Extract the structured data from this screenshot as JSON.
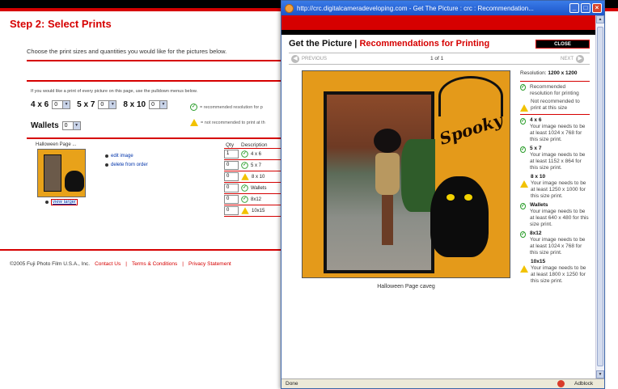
{
  "background_page": {
    "title": "Step 2: Select Prints",
    "intro": "Choose the print sizes and quantities you would like for the pictures below.",
    "pulldown_text": "If you would like a print of every picture on this page, use the pulldown menus below.",
    "sizes": [
      {
        "label": "4 x 6",
        "value": "0"
      },
      {
        "label": "5 x 7",
        "value": "0"
      },
      {
        "label": "8 x 10",
        "value": "0"
      }
    ],
    "wallets": {
      "label": "Wallets",
      "value": "0"
    },
    "legend_ok": "= recommended resolution for p",
    "legend_warn": "= not recommended to print at th",
    "product_heading": "Halloween Page ...",
    "edit_image": "edit image",
    "delete_from_order": "delete from order",
    "view_larger": "view larger",
    "qty_header": "Qty",
    "desc_header": "Description",
    "qty_rows": [
      {
        "qty": "1",
        "desc": "4 x 6",
        "status": "ok"
      },
      {
        "qty": "0",
        "desc": "5 x 7",
        "status": "ok"
      },
      {
        "qty": "0",
        "desc": "8 x 10",
        "status": "warn"
      },
      {
        "qty": "0",
        "desc": "Wallets",
        "status": "ok"
      },
      {
        "qty": "0",
        "desc": "8x12",
        "status": "ok"
      },
      {
        "qty": "0",
        "desc": "10x15",
        "status": "warn"
      }
    ],
    "footer": {
      "copyright": "©2005 Fuji Photo Film U.S.A., Inc.",
      "contact": "Contact Us",
      "terms": "Terms & Conditions",
      "privacy": "Privacy Statement",
      "separator": "|"
    }
  },
  "popup": {
    "window_title": "http://crc.digitalcameradeveloping.com - Get The Picture : crc : Recommendation...",
    "heading_black": "Get the Picture",
    "heading_sep": " | ",
    "heading_red": "Recommendations for Printing",
    "close_label": "CLOSE",
    "previous": "PREVIOUS",
    "next": "NEXT",
    "count": "1 of 1",
    "photo_text": "Spooky",
    "caption": "Halloween Page caveg",
    "resolution_label": "Resolution:",
    "resolution_value": "1200 x 1200",
    "recommended_text": "Recommended resolution for printing",
    "not_recommended_text": "Not recommended to print at this size",
    "size_items": [
      {
        "name": "4 x 6",
        "status": "ok",
        "text": "Your image needs to be at least 1024 x 768 for this size print."
      },
      {
        "name": "5 x 7",
        "status": "ok",
        "text": "Your image needs to be at least 1152 x 864 for this size print."
      },
      {
        "name": "8 x 10",
        "status": "warn",
        "text": "Your image needs to be at least 1250 x 1000 for this size print."
      },
      {
        "name": "Wallets",
        "status": "ok",
        "text": "Your image needs to be at least 640 x 480 for this size print."
      },
      {
        "name": "8x12",
        "status": "ok",
        "text": "Your image needs to be at least 1024 x 768 for this size print."
      },
      {
        "name": "10x15",
        "status": "warn",
        "text": "Your image needs to be at least 1800 x 1250 for this size print."
      }
    ],
    "status_done": "Done",
    "status_adblock": "Adblock"
  },
  "colors": {
    "brand_red": "#d60000",
    "ok_green": "#2a9d2a",
    "warn_yellow": "#f2c200",
    "titlebar_blue": "#1c55c9"
  }
}
